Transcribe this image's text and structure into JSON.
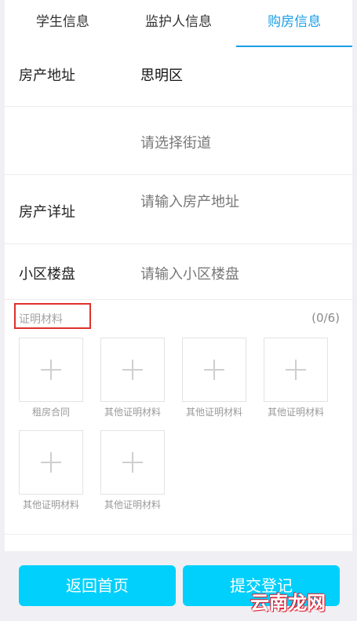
{
  "tabs": [
    {
      "label": "学生信息"
    },
    {
      "label": "监护人信息"
    },
    {
      "label": "购房信息"
    }
  ],
  "form": {
    "property_address": {
      "label": "房产地址",
      "district": "思明区",
      "street_placeholder": "请选择街道"
    },
    "property_detail": {
      "label": "房产详址",
      "placeholder": "请输入房产地址"
    },
    "community": {
      "label": "小区楼盘",
      "placeholder": "请输入小区楼盘"
    }
  },
  "proof": {
    "title": "证明材料",
    "count": "(0/6)",
    "items": [
      {
        "label": "租房合同"
      },
      {
        "label": "其他证明材料"
      },
      {
        "label": "其他证明材料"
      },
      {
        "label": "其他证明材料"
      },
      {
        "label": "其他证明材料"
      },
      {
        "label": "其他证明材料"
      }
    ]
  },
  "buttons": {
    "back": "返回首页",
    "submit": "提交登记"
  },
  "watermark": "云南龙网",
  "colors": {
    "accent": "#1a9de6",
    "button": "#00d0fb",
    "highlight_box": "#e0312b"
  }
}
